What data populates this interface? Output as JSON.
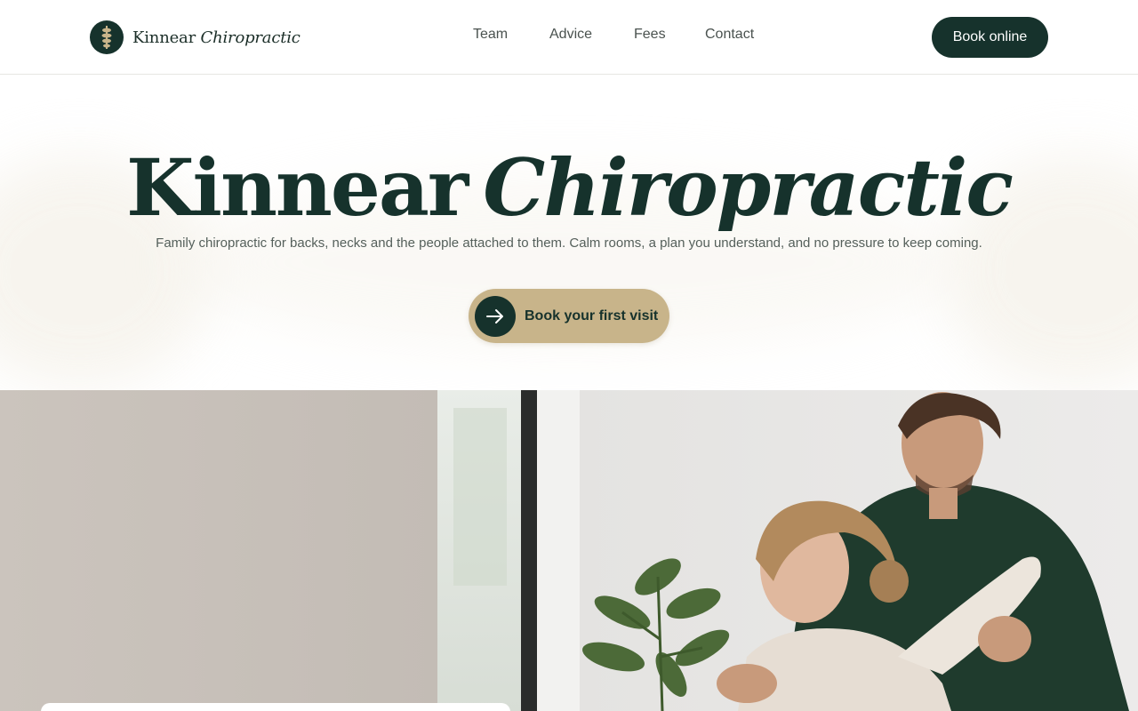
{
  "brand": {
    "name_plain": "Kinnear",
    "name_italic": "Chiropractic",
    "logo_icon": "spine-icon"
  },
  "nav": {
    "links": [
      "Team",
      "Advice",
      "Fees",
      "Contact"
    ],
    "cta_label": "Book online"
  },
  "hero": {
    "title_plain": "Kinnear",
    "title_italic": "Chiropractic",
    "subtitle": "Family chiropractic for backs, necks and the people attached to them. Calm rooms, a plan you understand, and no pressure to keep coming.",
    "cta_label": "Book your first visit",
    "cta_icon": "arrow-right-icon"
  },
  "colors": {
    "primary": "#16322c",
    "accent": "#c8b48a",
    "text_muted": "#55605b",
    "background": "#ffffff"
  }
}
